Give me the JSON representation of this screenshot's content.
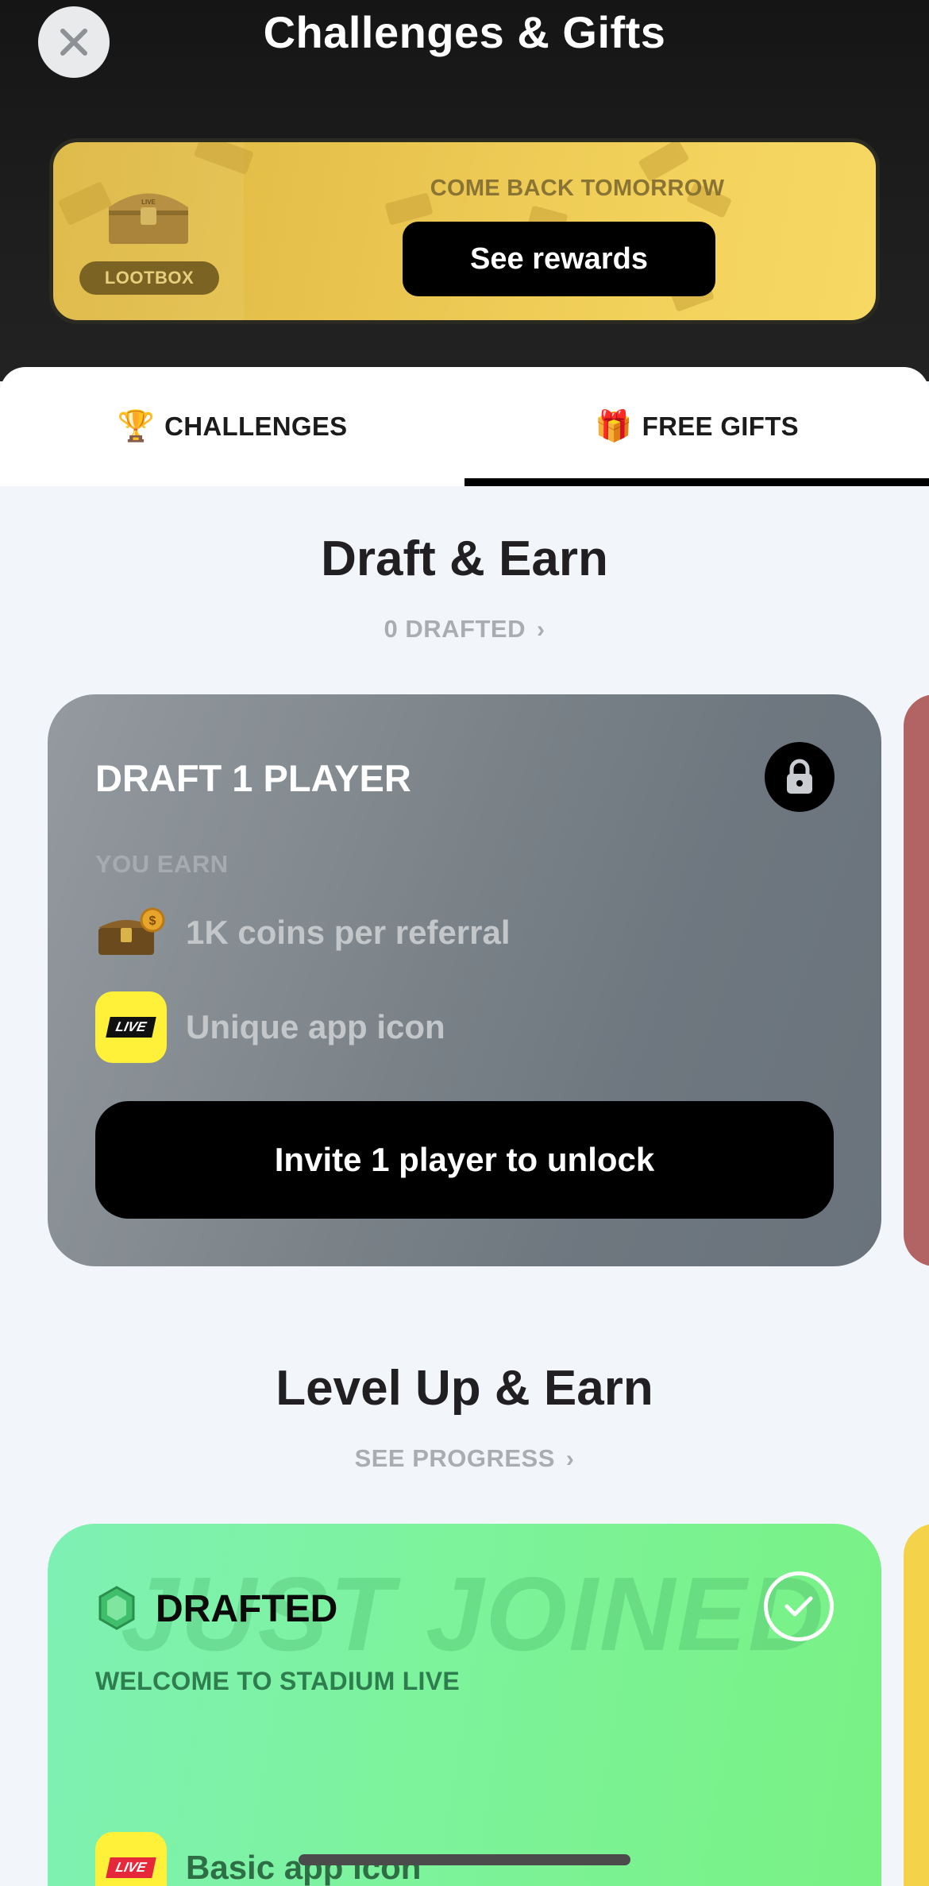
{
  "header": {
    "title": "Challenges & Gifts",
    "close_icon": "close-icon"
  },
  "lootbox_banner": {
    "badge_label": "LOOTBOX",
    "chest_icon": "treasure-chest-icon",
    "caption": "COME BACK TOMORROW",
    "button_label": "See rewards",
    "colors": {
      "gold": "#f2d15a",
      "dark": "#7a6323"
    }
  },
  "tabs": {
    "items": [
      {
        "label": "CHALLENGES",
        "icon": "trophy-icon",
        "emoji": "🏆",
        "selected": false
      },
      {
        "label": "FREE GIFTS",
        "icon": "gift-icon",
        "emoji": "🎁",
        "selected": true
      }
    ]
  },
  "draft_section": {
    "title": "Draft & Earn",
    "link_label": "0 DRAFTED",
    "card": {
      "heading": "DRAFT 1 PLAYER",
      "status_icon": "lock-icon",
      "earn_label": "YOU EARN",
      "rewards": [
        {
          "icon": "coin-chest-icon",
          "text": "1K coins per referral"
        },
        {
          "icon": "live-app-icon",
          "badge": "LIVE",
          "text": "Unique app icon"
        }
      ],
      "button_label": "Invite 1 player to unlock"
    }
  },
  "level_section": {
    "title": "Level Up & Earn",
    "link_label": "SEE PROGRESS",
    "card": {
      "watermark": "JUST JOINED",
      "gem_icon": "gem-icon",
      "heading": "DRAFTED",
      "status_icon": "check-icon",
      "subtitle": "WELCOME TO STADIUM LIVE",
      "reward": {
        "icon": "live-app-icon",
        "badge": "LIVE",
        "text": "Basic app icon"
      }
    }
  }
}
